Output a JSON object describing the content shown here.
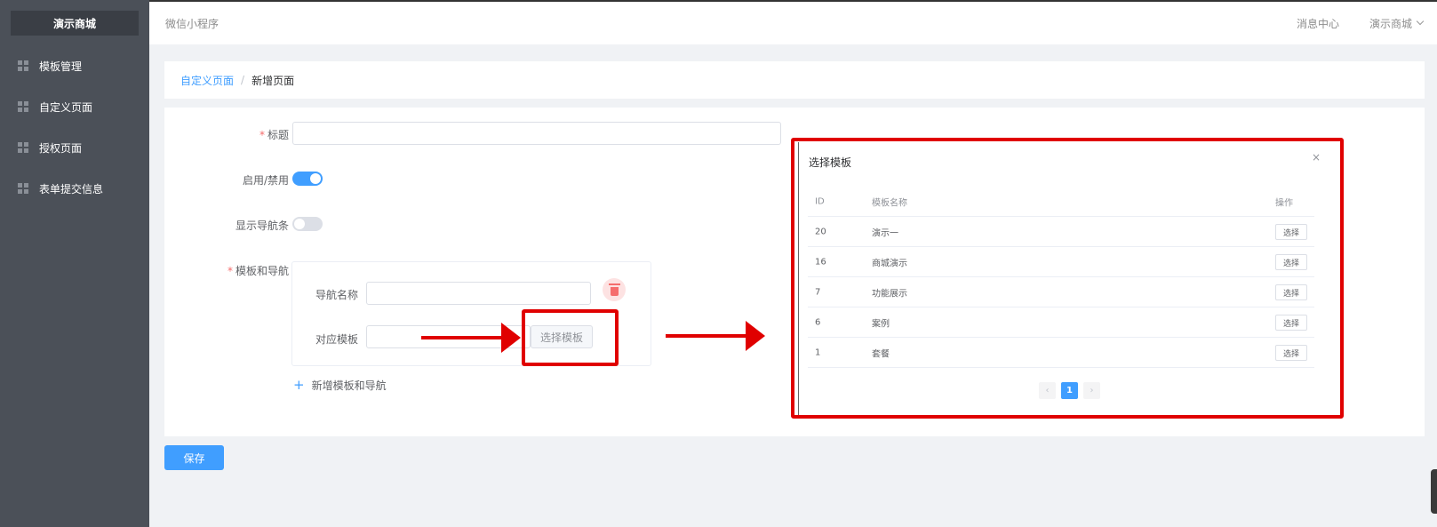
{
  "sidebar": {
    "brand": "演示商城",
    "items": [
      {
        "label": "模板管理",
        "icon": "grid-icon"
      },
      {
        "label": "自定义页面",
        "icon": "grid-icon"
      },
      {
        "label": "授权页面",
        "icon": "grid-icon"
      },
      {
        "label": "表单提交信息",
        "icon": "grid-icon"
      }
    ]
  },
  "header": {
    "app_name": "微信小程序",
    "message_center": "消息中心",
    "user_menu": "演示商城"
  },
  "breadcrumb": {
    "parent": "自定义页面",
    "separator": "/",
    "current": "新增页面"
  },
  "form": {
    "title_label": "标题",
    "title_value": "",
    "enable_label": "启用/禁用",
    "enable_on": true,
    "navbar_label": "显示导航条",
    "navbar_on": false,
    "template_nav_label": "模板和导航",
    "nav_name_label": "导航名称",
    "nav_name_value": "",
    "template_label": "对应模板",
    "template_value": "",
    "pick_template_button": "选择模板",
    "add_link": "新增模板和导航",
    "required_mark": "*"
  },
  "save_button": "保存",
  "modal": {
    "title": "选择模板",
    "close": "×",
    "columns": [
      "ID",
      "模板名称",
      "操作"
    ],
    "rows": [
      {
        "id": "20",
        "name": "演示一",
        "action": "选择"
      },
      {
        "id": "16",
        "name": "商城演示",
        "action": "选择"
      },
      {
        "id": "7",
        "name": "功能展示",
        "action": "选择"
      },
      {
        "id": "6",
        "name": "案例",
        "action": "选择"
      },
      {
        "id": "1",
        "name": "套餐",
        "action": "选择"
      }
    ],
    "pagination": {
      "prev": "‹",
      "current": "1",
      "next": "›"
    }
  },
  "colors": {
    "primary": "#409eff",
    "annotation_red": "#e00000",
    "sidebar_bg": "#4b5058"
  }
}
